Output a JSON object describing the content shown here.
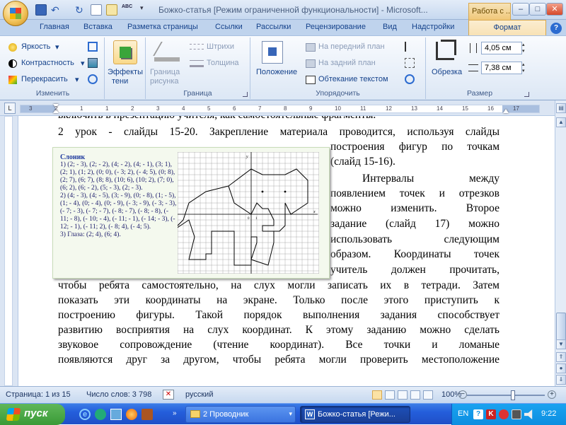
{
  "titlebar": {
    "title": "Божко-статья [Режим ограниченной функциональности] - Microsoft...",
    "context_tab": "Работа с ...",
    "min": "–",
    "max": "□",
    "close": "✕"
  },
  "tabs": [
    "Главная",
    "Вставка",
    "Разметка страницы",
    "Ссылки",
    "Рассылки",
    "Рецензирование",
    "Вид",
    "Надстройки"
  ],
  "format_tab": "Формат",
  "ribbon": {
    "change": {
      "label": "Изменить",
      "brightness": "Яркость",
      "contrast": "Контрастность",
      "recolor": "Перекрасить"
    },
    "effects": {
      "label": "Эффекты тени",
      "line1": "Эффекты",
      "line2": "тени"
    },
    "border": {
      "label": "Граница",
      "border_line1": "Граница",
      "border_line2": "рисунка",
      "dashes": "Штрихи",
      "weight": "Толщина"
    },
    "arrange": {
      "label": "Упорядочить",
      "position": "Положение",
      "front": "На передний план",
      "back": "На задний план",
      "wrap": "Обтекание текстом"
    },
    "size": {
      "label": "Размер",
      "crop": "Обрезка",
      "height": "4,05 см",
      "width": "7,38 см"
    }
  },
  "ruler_numbers": [
    "3",
    "2",
    "1",
    "1",
    "2",
    "3",
    "4",
    "5",
    "6",
    "7",
    "8",
    "9",
    "10",
    "11",
    "12",
    "13",
    "14",
    "15",
    "16",
    "17"
  ],
  "doc": {
    "line_top": "включить в презентацию учителя, как самостоятельные фрагменты.",
    "line1": "2 урок - слайды 15-20. Закрепление материала проводится, используя слайды",
    "r1": "построения фигур по точкам",
    "r2": "(слайд 15-16).",
    "r3": "Интервалы между",
    "r4": "появлением точек и отрезков",
    "r5": "можно изменить. Второе",
    "r6": "задание (слайд 17) можно",
    "r7": "использовать следующим",
    "r8": "образом. Координаты точек",
    "r9": "учитель должен прочитать,",
    "f1": "чтобы ребята самостоятельно, на слух могли записать их в тетради. Затем",
    "f2": "показать эти координаты на экране. Только после этого приступить к",
    "f3": "построению фигуры. Такой порядок выполнения задания способствует",
    "f4": "развитию восприятия на слух координат. К этому заданию можно сделать",
    "f5": "звуковое сопровождение (чтение координат). Все точки и ломаные",
    "f6": "появляются друг за другом, чтобы ребята могли проверить местоположение"
  },
  "figure": {
    "title": "Слоник",
    "t1": "1) (2; - 3), (2; - 2), (4; - 2), (4; - 1), (3; 1), (2; 1), (1; 2), (0; 0), (- 3; 2), (- 4; 5), (0; 8), (2; 7), (6; 7), (8; 8), (10; 6), (10; 2), (7; 0), (6; 2), (6; - 2), (5; - 3), (2; - 3).",
    "t2": "2) (4; - 3), (4; - 5), (3; - 9), (0; - 8), (1; - 5), (1; - 4), (0; - 4), (0; - 9), (- 3; - 9), (- 3; - 3), (- 7; - 3), (- 7; - 7), (- 8; - 7), (- 8; - 8), (- 11; - 8), (- 10; - 4), (- 11; - 1), (- 14; - 3), (- 12; - 1), (- 11; 2), (- 8; 4), (- 4; 5).",
    "t3": "3) Глаза: (2; 4), (6; 4).",
    "axis_y": "y",
    "axis_x": "x",
    "origin": "0",
    "one": "1"
  },
  "status": {
    "page": "Страница: 1 из 15",
    "words": "Число слов: 3 798",
    "lang": "русский",
    "zoom": "100%"
  },
  "taskbar": {
    "start": "пуск",
    "explorer": "2 Проводник",
    "word": "Божко-статья [Режи...",
    "lang": "EN",
    "time": "9:22"
  }
}
